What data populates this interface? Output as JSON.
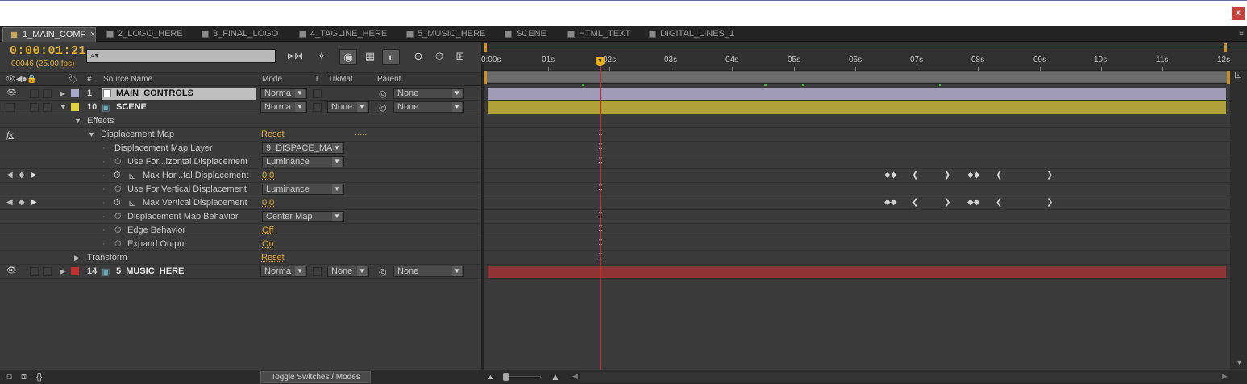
{
  "window": {
    "close_label": "x"
  },
  "tabs": [
    {
      "label": "1_MAIN_COMP",
      "active": true,
      "close": "×"
    },
    {
      "label": "2_LOGO_HERE"
    },
    {
      "label": "3_FINAL_LOGO"
    },
    {
      "label": "4_TAGLINE_HERE"
    },
    {
      "label": "5_MUSIC_HERE"
    },
    {
      "label": "SCENE"
    },
    {
      "label": "HTML_TEXT"
    },
    {
      "label": "DIGITAL_LINES_1"
    }
  ],
  "tab_menu_icon": "≡",
  "controls": {
    "timecode": "0:00:01:21",
    "frames": "00046 (25.00 fps)",
    "search_placeholder": "⌕▾",
    "tool_icons": [
      "draft-3d-icon",
      "shy-icon",
      "motion-blur-icon",
      "frame-blend-icon",
      "graph-editor-icon",
      "live-update-icon",
      "brainstorm-icon",
      "comp-flowchart-icon"
    ]
  },
  "columns": {
    "switches_icons": "👁◀●🔒",
    "label_icon": "🏷",
    "number": "#",
    "source_name": "Source Name",
    "mode": "Mode",
    "t": "T",
    "trkmat": "TrkMat",
    "parent": "Parent"
  },
  "layers": {
    "main_controls": {
      "number": "1",
      "name": "MAIN_CONTROLS",
      "mode": "Norma",
      "parent": "None",
      "label_color": "#a8a8c8"
    },
    "scene": {
      "number": "10",
      "name": "SCENE",
      "mode": "Norma",
      "trkmat": "None",
      "parent": "None",
      "label_color": "#e0d040"
    },
    "music": {
      "number": "14",
      "name": "5_MUSIC_HERE",
      "mode": "Norma",
      "trkmat": "None",
      "parent": "None",
      "label_color": "#c03030"
    }
  },
  "properties": {
    "effects": "Effects",
    "fx_icon": "fx",
    "displacement_map": "Displacement Map",
    "dm_reset": "Reset",
    "dm_dots": ".....",
    "dm_layer": "Displacement Map Layer",
    "dm_layer_value": "9. DISPACE_MA",
    "use_h": "Use For...izontal Displacement",
    "use_h_value": "Luminance",
    "max_h": "Max Hor...tal Displacement",
    "max_h_value": "0,0",
    "use_v": "Use For Vertical Displacement",
    "use_v_value": "Luminance",
    "max_v": "Max Vertical Displacement",
    "max_v_value": "0,0",
    "behavior": "Displacement Map Behavior",
    "behavior_value": "Center Map",
    "edge": "Edge Behavior",
    "edge_value": "Off",
    "expand": "Expand Output",
    "expand_value": "On",
    "transform": "Transform",
    "transform_reset": "Reset"
  },
  "ruler": {
    "labels": [
      "0:00s",
      "01s",
      "02s",
      "03s",
      "04s",
      "05s",
      "06s",
      "07s",
      "08s",
      "09s",
      "10s",
      "11s",
      "12s"
    ]
  },
  "colors": {
    "main_controls_bar": "#a09cb8",
    "scene_bar": "#b0a238",
    "music_bar": "#8e3434",
    "cti": "#e02020",
    "timecode": "#e0b030"
  },
  "footer": {
    "toggle_label": "Toggle Switches / Modes",
    "icons": [
      "comp-button-icon",
      "layer-button-icon",
      "expand-icon"
    ]
  }
}
